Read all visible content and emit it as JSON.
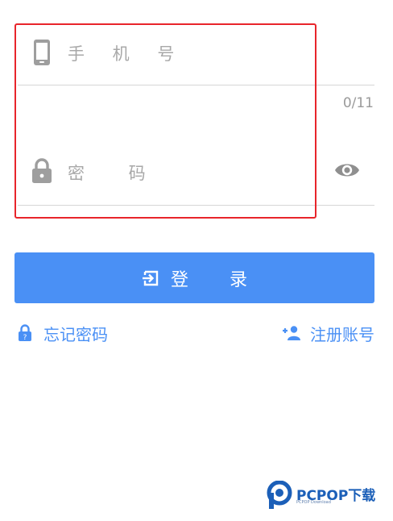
{
  "phone": {
    "placeholder": "手 机 号",
    "value": "",
    "counter": "0/11"
  },
  "password": {
    "placeholder": "密 码",
    "value": ""
  },
  "login": {
    "label": "登 录"
  },
  "links": {
    "forgot": "忘记密码",
    "register": "注册账号"
  },
  "watermark": {
    "brand": "PCPOP下载",
    "sub": "PCPOP Download"
  },
  "colors": {
    "accent": "#4a90f5",
    "highlight": "#e8252b",
    "icon_gray": "#9e9e9e"
  },
  "icons": {
    "phone": "smartphone-icon",
    "lock": "lock-icon",
    "eye": "eye-icon",
    "login": "login-arrow-icon",
    "forgot": "lock-small-icon",
    "register": "add-person-icon"
  }
}
